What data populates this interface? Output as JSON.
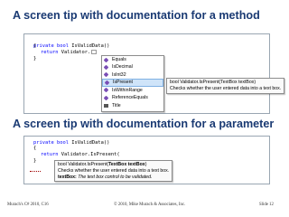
{
  "slide": {
    "title_method": "A screen tip with documentation for a method",
    "title_parameter": "A screen tip with documentation for a parameter",
    "footer_left": "Murach's C# 2010, C16",
    "footer_center": "© 2010, Mike Murach & Associates, Inc.",
    "footer_right": "Slide 12"
  },
  "code_method": {
    "line1_kw": "private bool",
    "line1_rest": " IsValidData()",
    "line2": "{",
    "line3_kw": "return",
    "line3_rest": " Validator.",
    "line4": "}"
  },
  "intellisense": {
    "items": [
      {
        "label": "Equals",
        "icon": "method-icon"
      },
      {
        "label": "IsDecimal",
        "icon": "method-icon"
      },
      {
        "label": "IsInt32",
        "icon": "method-icon"
      },
      {
        "label": "IsPresent",
        "icon": "method-icon",
        "selected": true
      },
      {
        "label": "IsWithinRange",
        "icon": "method-icon"
      },
      {
        "label": "ReferenceEquals",
        "icon": "method-icon"
      },
      {
        "label": "Title",
        "icon": "property-icon"
      }
    ],
    "tip_line1": "bool Validator.IsPresent(TextBox textBox)",
    "tip_line2": "Checks whether the user entered data into a text box."
  },
  "code_parameter": {
    "line1_kw": "private bool",
    "line1_rest": " IsValidData()",
    "line2": "{",
    "line3_kw": "return",
    "line3_rest": " Validator.IsPresent(",
    "line4": "}"
  },
  "param_tip": {
    "sig_prefix": "bool Validator.IsPresent(",
    "sig_bold": "TextBox textBox",
    "sig_suffix": ")",
    "desc": "Checks whether the user entered data into a text box.",
    "param_name": "textBox:",
    "param_desc": " The text box control to be validated."
  }
}
